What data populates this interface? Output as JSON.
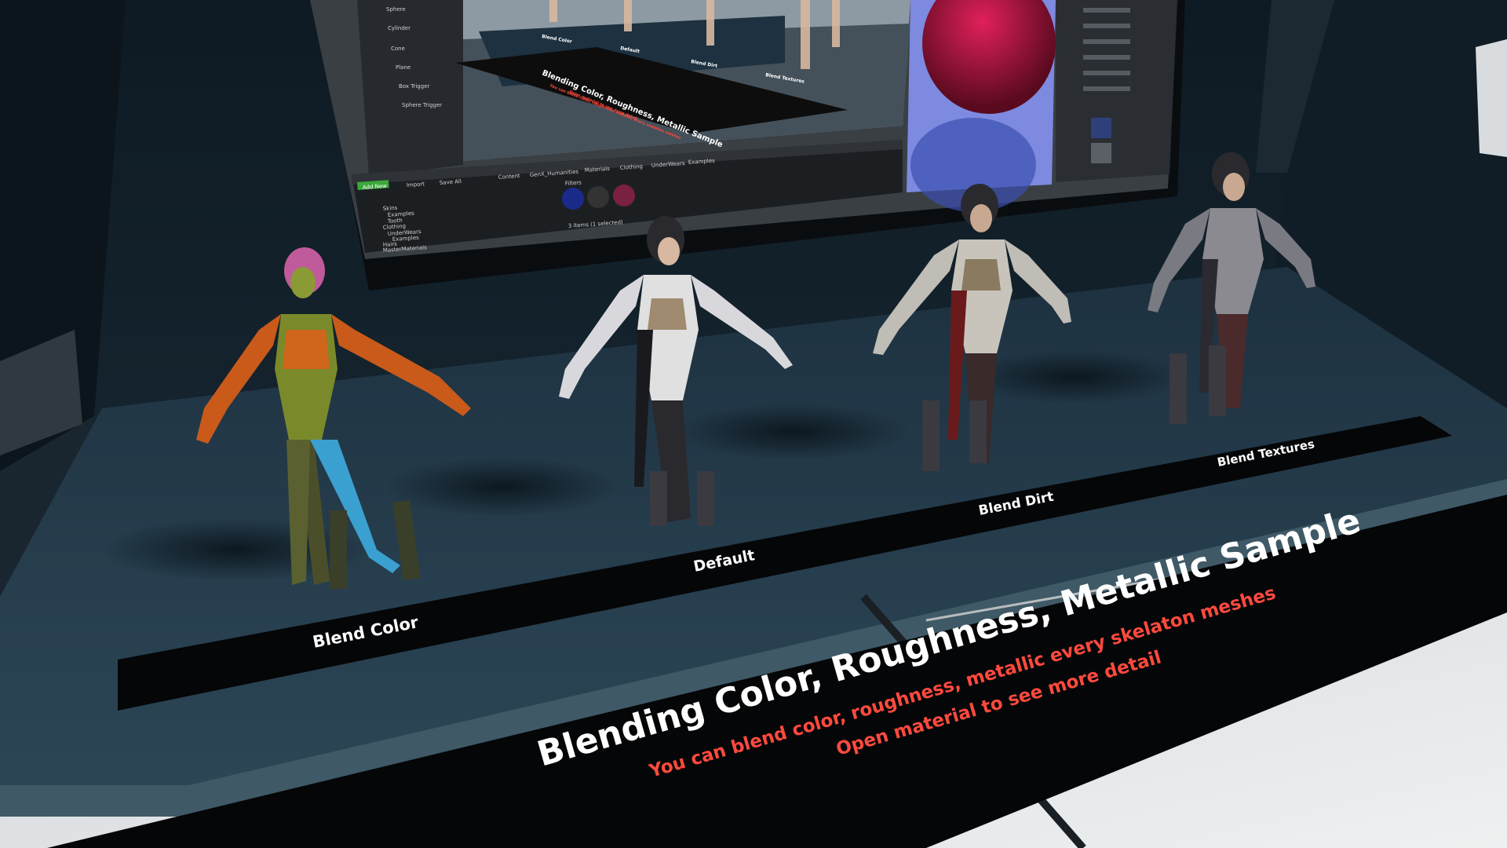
{
  "scene": {
    "pedestal_labels": [
      "Blend Color",
      "Default",
      "Blend Dirt",
      "Blend Textures"
    ],
    "sign": {
      "title": "Blending Color, Roughness, Metallic Sample",
      "line1": "You can blend color, roughness, metallic every skelaton meshes",
      "line2": "Open material to see more detail"
    }
  },
  "editor_screen": {
    "place_actors": [
      "Sphere",
      "Cylinder",
      "Cone",
      "Plane",
      "Box Trigger",
      "Sphere Trigger"
    ],
    "content_browser": {
      "add_new": "Add New",
      "import": "Import",
      "save_all": "Save All",
      "path": [
        "Content",
        "GenX_Humanities",
        "Materials",
        "Clothing",
        "UnderWears",
        "Examples"
      ],
      "tree": [
        "Skins",
        "Examples",
        "Tooth",
        "Clothing",
        "UnderWears",
        "Examples",
        "Hairs",
        "MasterMaterials"
      ],
      "filters": "Filters",
      "status": "3 items (1 selected)"
    },
    "mini_scene": {
      "labels": [
        "Blend Color",
        "Default",
        "Blend Dirt",
        "Blend Textures"
      ],
      "sign_title": "Blending Color, Roughness, Metallic Sample",
      "sign_sub": "You can blend color, roughness, metallic every skeleton meshes",
      "sign_sub2": "Open material to see more detail"
    }
  },
  "colors": {
    "sign_red": "#ff4a3d",
    "floor_dark": "#1f3442",
    "label_white": "#ffffff"
  }
}
